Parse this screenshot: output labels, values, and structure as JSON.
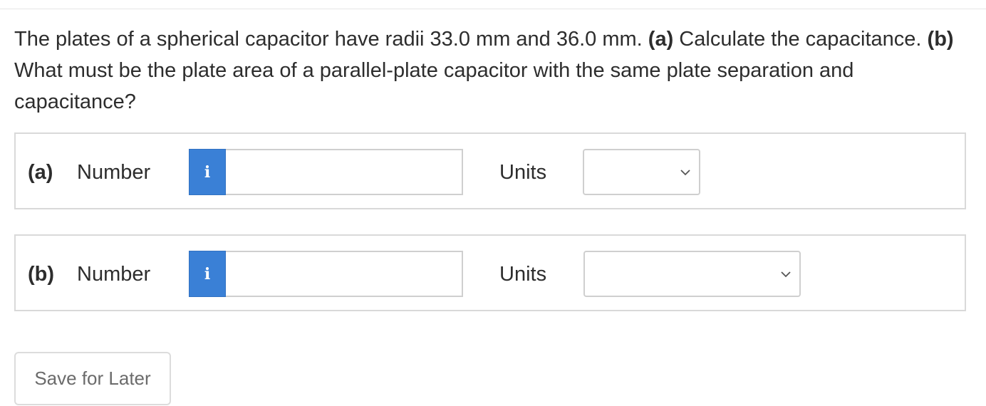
{
  "question": {
    "intro": "The plates of a spherical capacitor have radii 33.0 mm and 36.0 mm. ",
    "part_a_tag": "(a)",
    "part_a_text": " Calculate the capacitance. ",
    "part_b_tag": "(b)",
    "part_b_text": " What must be the plate area of a parallel-plate capacitor with the same plate separation and capacitance?"
  },
  "parts": [
    {
      "label": "(a)",
      "number_label": "Number",
      "info_icon_glyph": "i",
      "number_value": "",
      "units_label": "Units",
      "units_value": ""
    },
    {
      "label": "(b)",
      "number_label": "Number",
      "info_icon_glyph": "i",
      "number_value": "",
      "units_label": "Units",
      "units_value": ""
    }
  ],
  "icons": {
    "info": "info-icon",
    "dropdown": "chevron-down-icon"
  },
  "colors": {
    "info_button": "#3a80d6",
    "border": "#d9d9d9",
    "text": "#2d2d2d"
  },
  "footer": {
    "save_label": "Save for Later"
  }
}
